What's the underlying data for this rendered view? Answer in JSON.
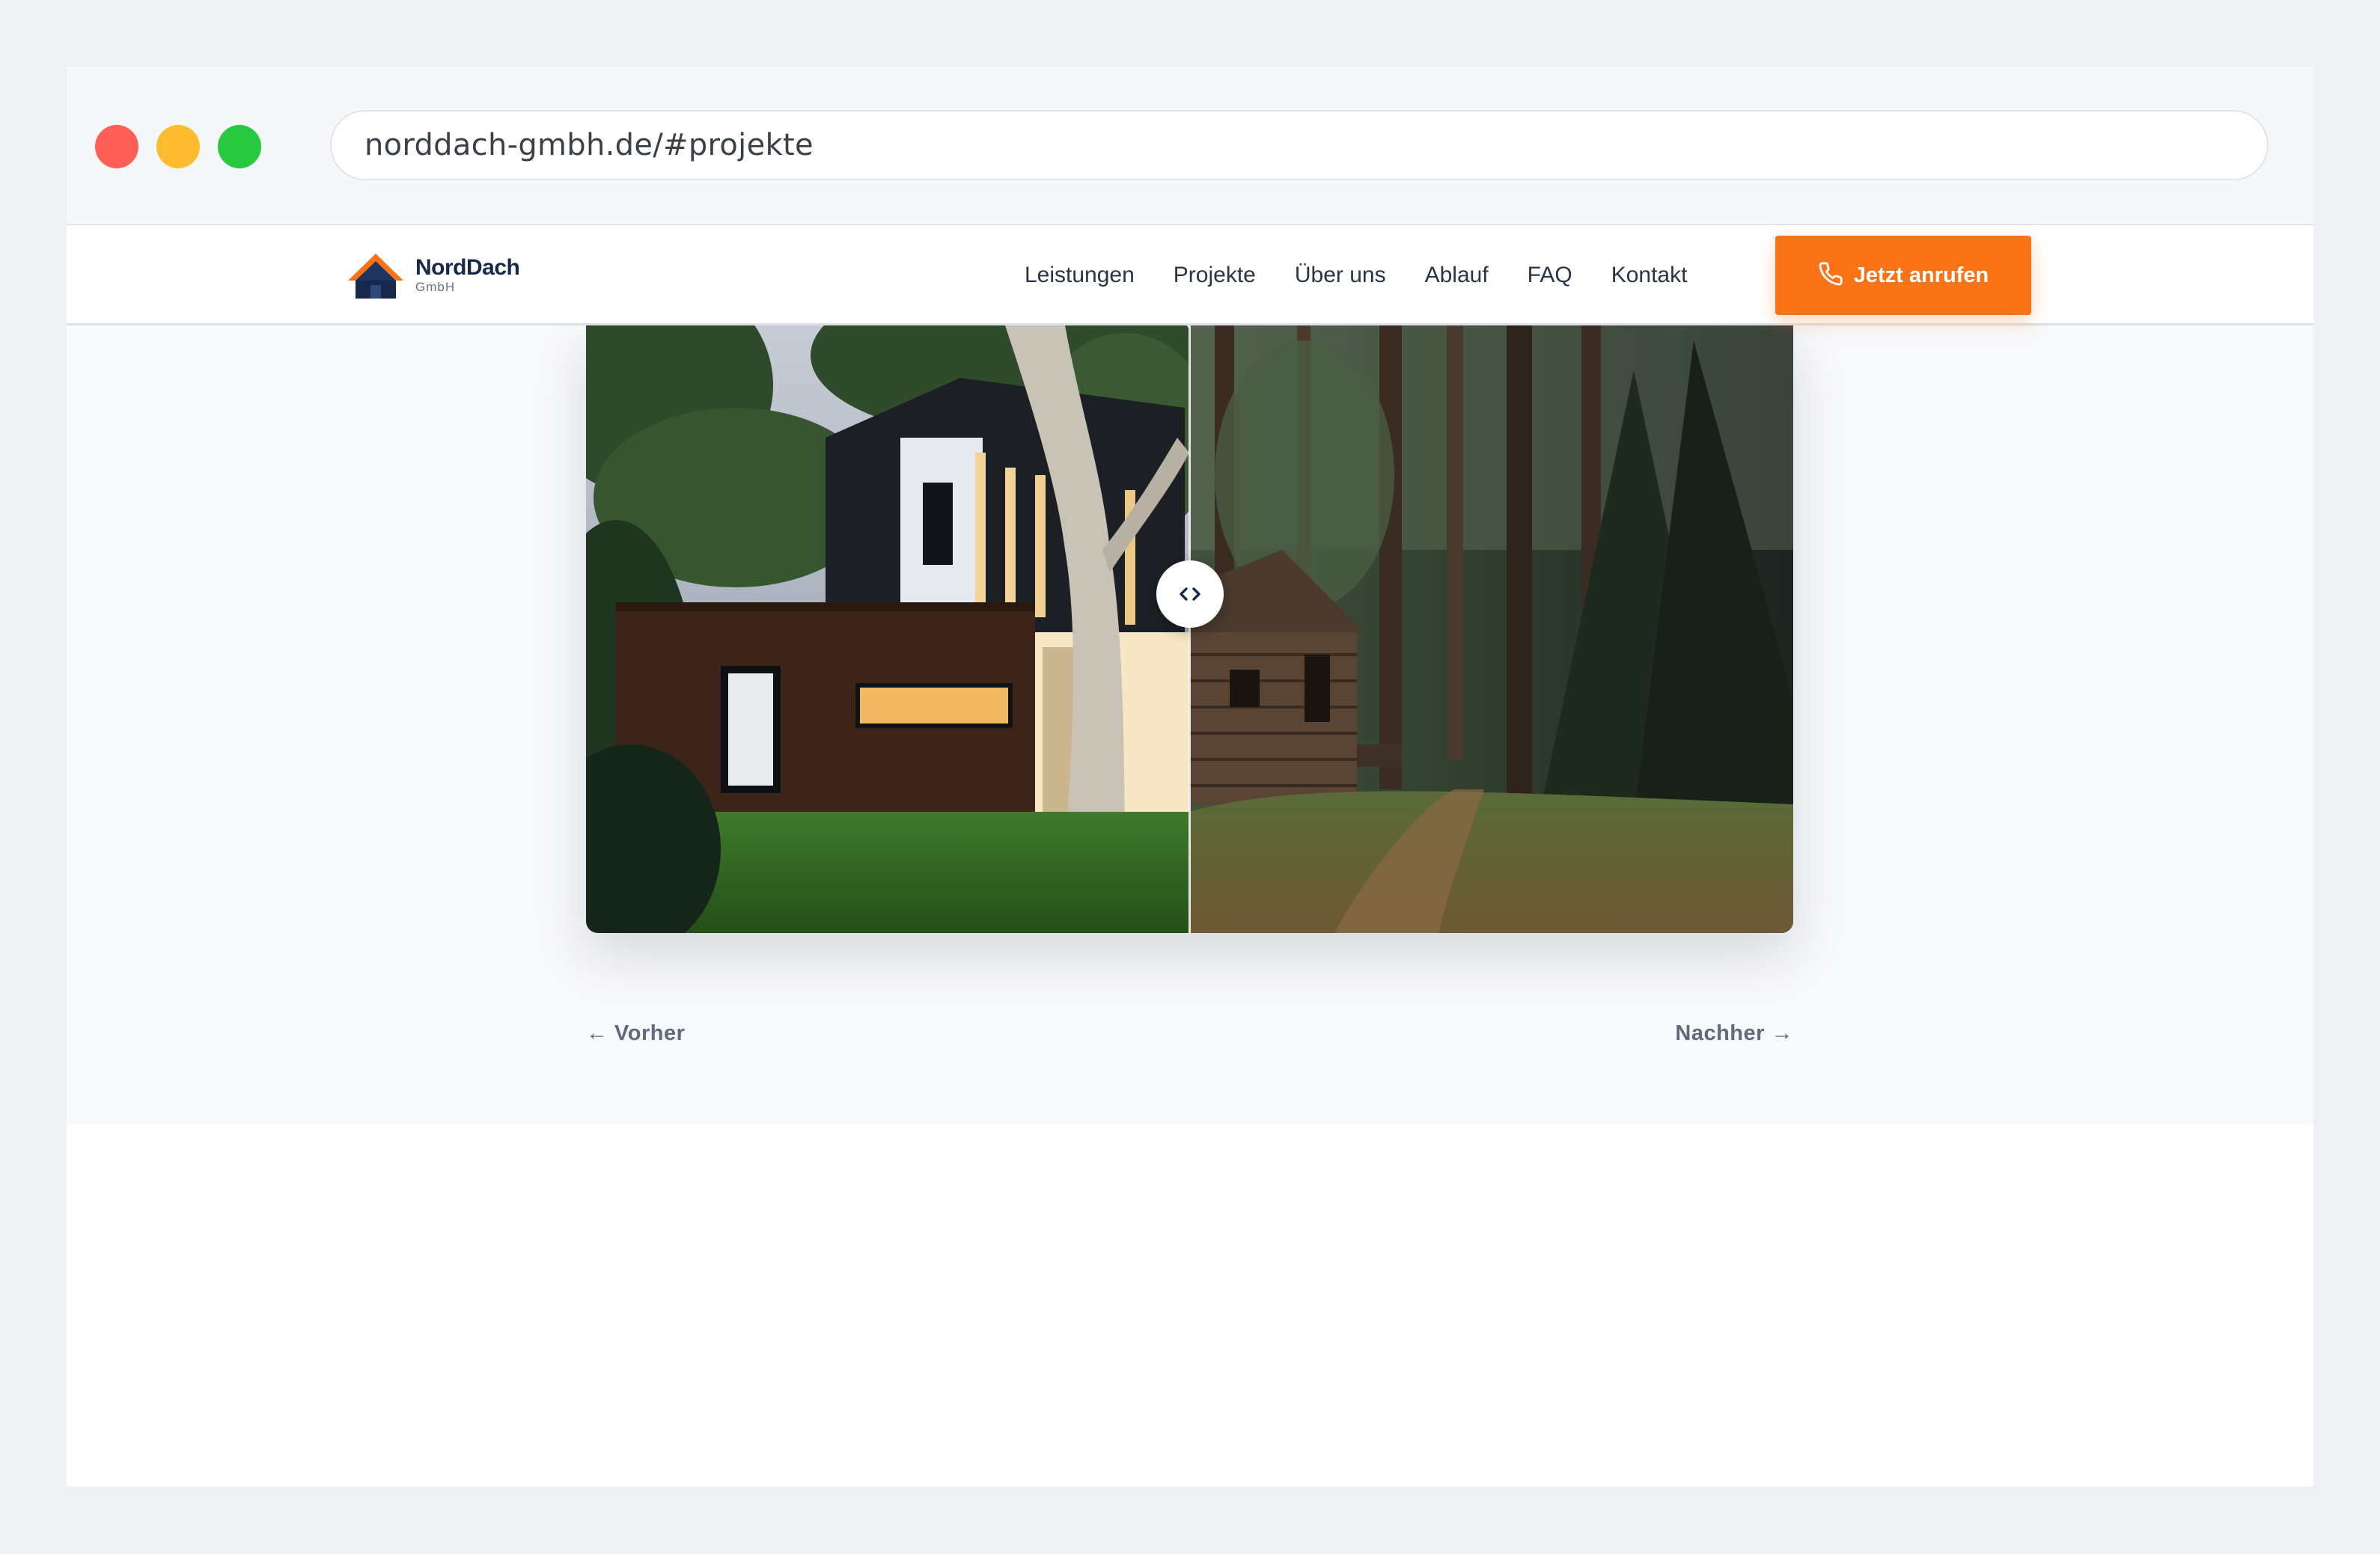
{
  "browser": {
    "url": "norddach-gmbh.de/#projekte"
  },
  "header": {
    "logo_name": "NordDach",
    "logo_sub": "GmbH",
    "nav": [
      "Leistungen",
      "Projekte",
      "Über uns",
      "Ablauf",
      "FAQ",
      "Kontakt"
    ],
    "cta_label": "Jetzt anrufen"
  },
  "comparison": {
    "before_label": "← Vorher",
    "after_label": "Nachher →",
    "slider_position": 0.5
  },
  "colors": {
    "accent": "#fa7316",
    "brand_navy": "#16294d",
    "page_bg": "#f8f9fb"
  },
  "icons": {
    "cta": "phone-icon",
    "handle": "chevrons-left-right-icon",
    "logo": "roof-house-icon"
  }
}
